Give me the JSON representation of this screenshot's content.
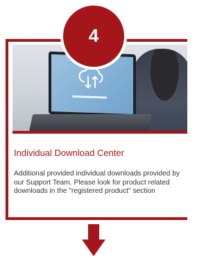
{
  "step": {
    "number": "4"
  },
  "card": {
    "title": "Individual Download Center",
    "description": "Additional provided individual downloads provided by our Support Team. Please look for product related downloads in the \"registered product\" section"
  },
  "colors": {
    "accent": "#a4161a",
    "text": "#333333"
  },
  "icons": {
    "hero": "laptop-cloud-download-icon",
    "down": "down-arrow-icon"
  }
}
